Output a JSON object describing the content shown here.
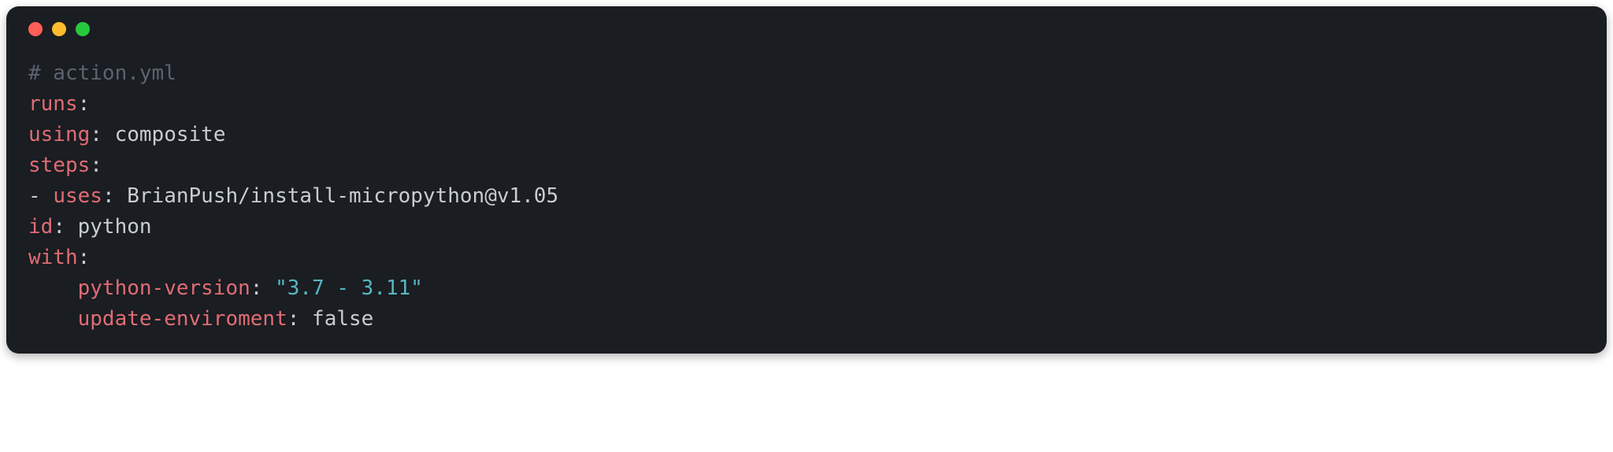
{
  "window": {
    "controls": {
      "close": "close",
      "minimize": "minimize",
      "maximize": "maximize"
    }
  },
  "code": {
    "comment": "# action.yml",
    "line2_key": "runs",
    "line2_colon": ":",
    "line3_key": "using",
    "line3_colon": ":",
    "line3_value": " composite",
    "line4_key": "steps",
    "line4_colon": ":",
    "line5_dash": "- ",
    "line5_key": "uses",
    "line5_colon": ":",
    "line5_value": " BrianPush/install-micropython@v1.05",
    "line6_key": "id",
    "line6_colon": ":",
    "line6_value": " python",
    "line7_key": "with",
    "line7_colon": ":",
    "line8_indent": "    ",
    "line8_key": "python-version",
    "line8_colon": ":",
    "line8_space": " ",
    "line8_value": "\"3.7 - 3.11\"",
    "line9_indent": "    ",
    "line9_key": "update-enviroment",
    "line9_colon": ":",
    "line9_space": " ",
    "line9_value": "false"
  }
}
